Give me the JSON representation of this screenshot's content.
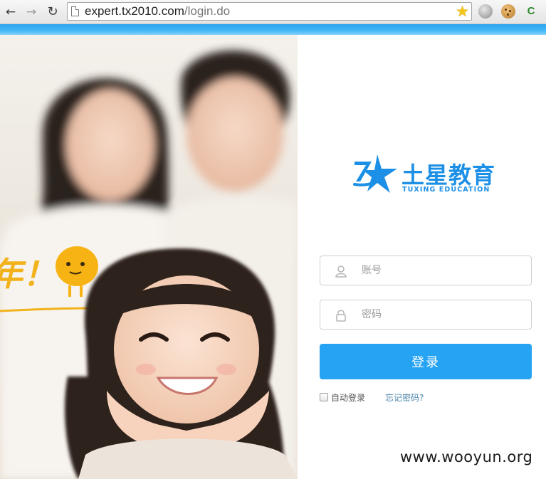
{
  "browser": {
    "url_host": "expert.tx2010.com",
    "url_path": "/login.do",
    "icons": [
      "back-arrow-icon",
      "forward-arrow-icon",
      "reload-icon",
      "page-icon",
      "bookmark-star-icon",
      "globe-extension-icon",
      "cookie-extension-icon",
      "c-extension-icon"
    ],
    "extension_letter": "C"
  },
  "banner": {
    "slogan_fragment": "年！",
    "colors": {
      "slogan": "#f2b21b",
      "mascot": "#f6b313"
    }
  },
  "login": {
    "logo": {
      "cn": "土星教育",
      "en": "TUXING EDUCATION",
      "icon": "tuxing-tx-logo-icon",
      "color": "#1c8fe6"
    },
    "username": {
      "placeholder": "账号",
      "value": "",
      "icon": "user-icon"
    },
    "password": {
      "placeholder": "密码",
      "value": "",
      "icon": "lock-icon"
    },
    "submit_label": "登录",
    "remember_label": "自动登录",
    "remember_checked": false,
    "forgot_label": "忘记密码?",
    "colors": {
      "accent": "#26a3f3",
      "top_bar": "#2ba6ef"
    }
  },
  "watermark": "www.wooyun.org"
}
